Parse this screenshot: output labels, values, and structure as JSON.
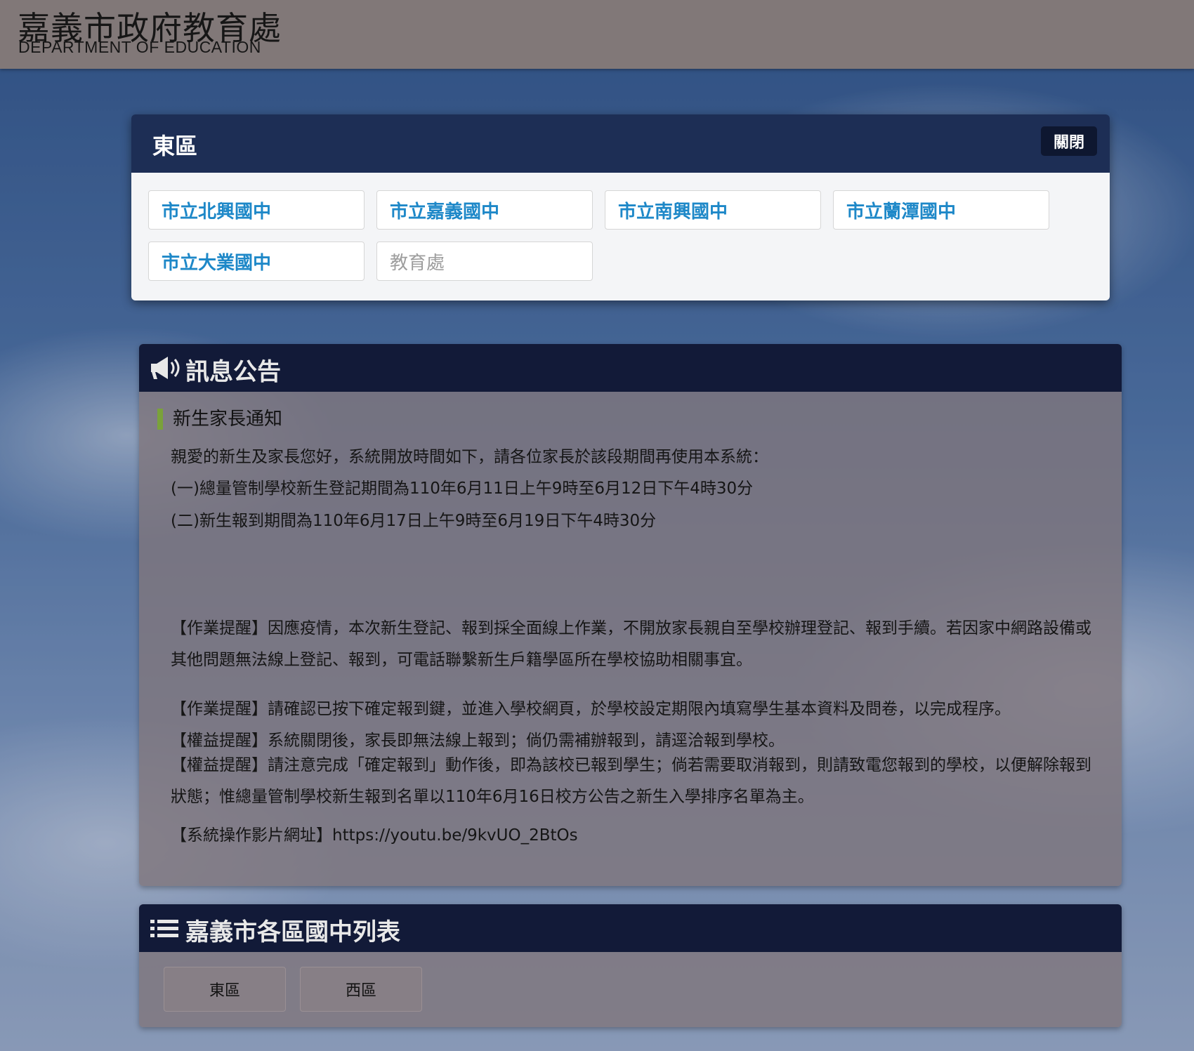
{
  "header": {
    "title_zh": "嘉義市政府教育處",
    "title_en": "DEPARTMENT OF EDUCATION"
  },
  "modal": {
    "title": "東區",
    "close_label": "關閉",
    "schools": [
      {
        "label": "市立北興國中",
        "enabled": true
      },
      {
        "label": "市立嘉義國中",
        "enabled": true
      },
      {
        "label": "市立南興國中",
        "enabled": true
      },
      {
        "label": "市立蘭潭國中",
        "enabled": true
      },
      {
        "label": "市立大業國中",
        "enabled": true
      },
      {
        "label": "教育處",
        "enabled": false
      }
    ]
  },
  "announcement": {
    "heading": "訊息公告",
    "subtitle": "新生家長通知",
    "intro": "親愛的新生及家長您好，系統開放時間如下，請各位家長於該段期間再使用本系統：",
    "period1": "(一)總量管制學校新生登記期間為110年6月11日上午9時至6月12日下午4時30分",
    "period2": "(二)新生報到期間為110年6月17日上午9時至6月19日下午4時30分",
    "reminder1": "【作業提醒】因應疫情，本次新生登記、報到採全面線上作業，不開放家長親自至學校辦理登記、報到手續。若因家中網路設備或其他問題無法線上登記、報到，可電話聯繫新生戶籍學區所在學校協助相關事宜。",
    "reminder2": "【作業提醒】請確認已按下確定報到鍵，並進入學校網頁，於學校設定期限內填寫學生基本資料及問卷，以完成程序。",
    "rights1": "【權益提醒】系統關閉後，家長即無法線上報到；倘仍需補辦報到，請逕洽報到學校。",
    "rights2": "【權益提醒】請注意完成「確定報到」動作後，即為該校已報到學生；倘若需要取消報到，則請致電您報到的學校，以便解除報到狀態；惟總量管制學校新生報到名單以110年6月16日校方公告之新生入學排序名單為主。",
    "video_label": "【系統操作影片網址】",
    "video_url": "https://youtu.be/9kvUO_2BtOs"
  },
  "school_list": {
    "heading": "嘉義市各區國中列表",
    "regions": [
      "東區",
      "西區"
    ]
  }
}
